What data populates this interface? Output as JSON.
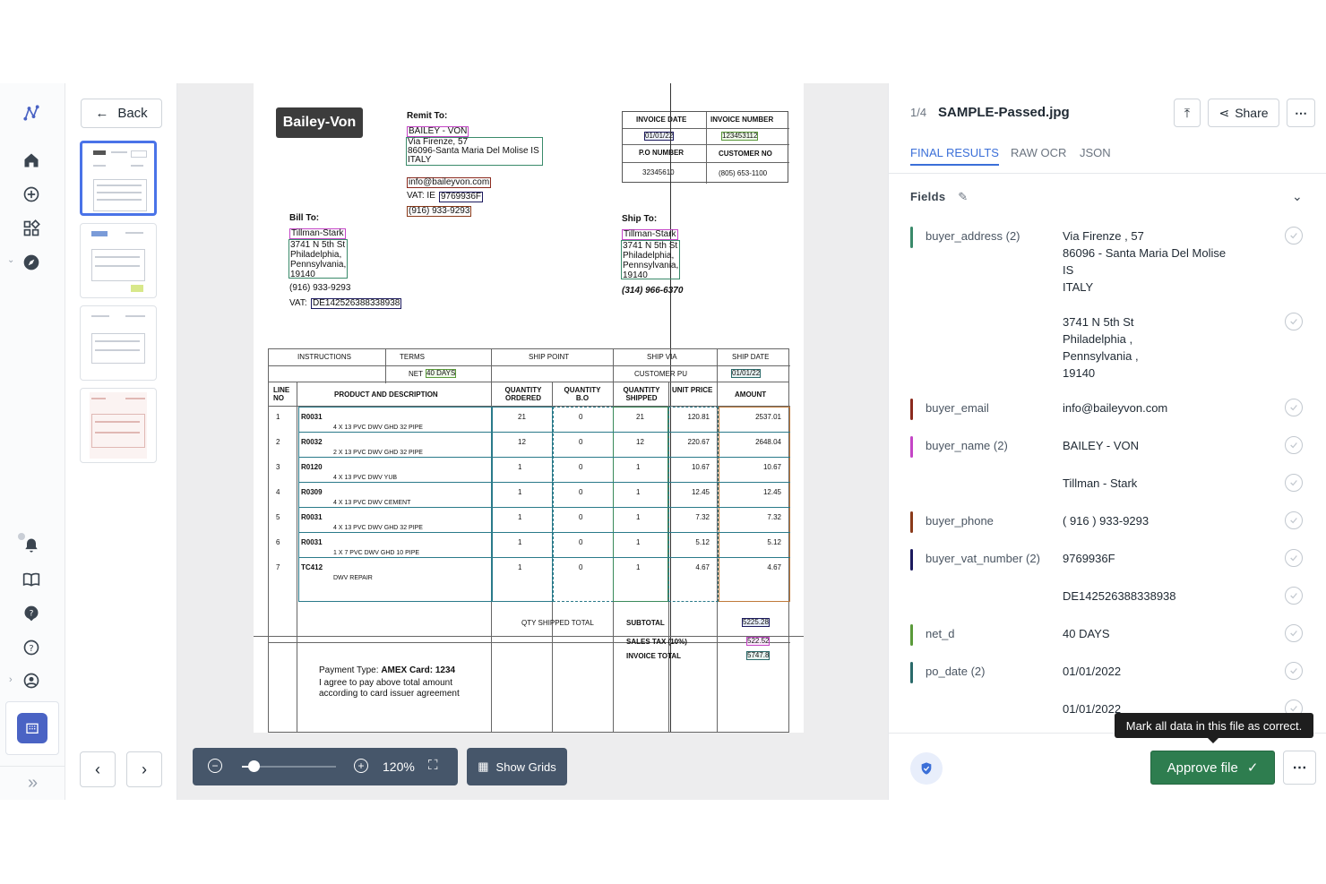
{
  "viewer": {
    "back_label": "Back",
    "zoom_level": "120%",
    "zoom_slider_value": 0.12,
    "show_grids_label": "Show Grids"
  },
  "document": {
    "vendor_logo": "Bailey-Von",
    "remit_to_label": "Remit To:",
    "remit_name": "BAILEY - VON",
    "remit_address": [
      "Via Firenze, 57",
      "86096-Santa Maria Del Molise IS",
      "ITALY"
    ],
    "remit_email": "info@baileyvon.com",
    "remit_vat_label": "VAT: IE",
    "remit_vat": "9769936F",
    "remit_phone": "(916) 933-9293",
    "invoice_date_label": "INVOICE DATE",
    "invoice_number_label": "INVOICE NUMBER",
    "invoice_date": "01/01/22",
    "invoice_number": "123453112",
    "po_number_label": "P.O NUMBER",
    "customer_no_label": "CUSTOMER NO",
    "po_number": "32345610",
    "customer_no": "(805) 653-1100",
    "bill_to_label": "Bill To:",
    "bill_name": "Tillman-Stark",
    "bill_address": [
      "3741 N 5th St",
      "Philadelphia,",
      "Pennsylvania,",
      "19140"
    ],
    "bill_phone": "(916) 933-9293",
    "bill_vat_label": "VAT:",
    "bill_vat": "DE142526388338938",
    "ship_to_label": "Ship To:",
    "ship_name": "Tillman-Stark",
    "ship_address": [
      "3741 N 5th St",
      "Philadelphia,",
      "Pennsylvania,",
      "19140"
    ],
    "ship_phone": "(314) 966-6370",
    "col_instructions": "INSTRUCTIONS",
    "col_terms": "TERMS",
    "col_ship_point": "SHIP POINT",
    "col_ship_via": "SHIP VIA",
    "col_ship_date": "SHIP DATE",
    "terms_value_prefix": "NET",
    "terms_value": "40 DAYS",
    "ship_via_value": "CUSTOMER PU",
    "ship_date_value": "01/01/22",
    "h_line_no": "LINE NO",
    "h_product": "PRODUCT AND DESCRIPTION",
    "h_qty_ordered": "QUANTITY ORDERED",
    "h_qty_bo": "QUANTITY B.O",
    "h_qty_shipped": "QUANTITY SHIPPED",
    "h_unit_price": "UNIT PRICE",
    "h_amount": "AMOUNT",
    "lines": [
      {
        "no": "1",
        "code": "R0031",
        "desc": "4 X 13 PVC DWV GHD 32 PIPE",
        "ordered": "21",
        "bo": "0",
        "shipped": "21",
        "price": "120.81",
        "amount": "2537.01"
      },
      {
        "no": "2",
        "code": "R0032",
        "desc": "2 X 13 PVC DWV GHD 32 PIPE",
        "ordered": "12",
        "bo": "0",
        "shipped": "12",
        "price": "220.67",
        "amount": "2648.04"
      },
      {
        "no": "3",
        "code": "R0120",
        "desc": "4 X 13 PVC DWV YUB",
        "ordered": "1",
        "bo": "0",
        "shipped": "1",
        "price": "10.67",
        "amount": "10.67"
      },
      {
        "no": "4",
        "code": "R0309",
        "desc": "4 X 13 PVC DWV CEMENT",
        "ordered": "1",
        "bo": "0",
        "shipped": "1",
        "price": "12.45",
        "amount": "12.45"
      },
      {
        "no": "5",
        "code": "R0031",
        "desc": "4 X 13 PVC DWV GHD 32 PIPE",
        "ordered": "1",
        "bo": "0",
        "shipped": "1",
        "price": "7.32",
        "amount": "7.32"
      },
      {
        "no": "6",
        "code": "R0031",
        "desc": "1 X 7 PVC DWV GHD 10 PIPE",
        "ordered": "1",
        "bo": "0",
        "shipped": "1",
        "price": "5.12",
        "amount": "5.12"
      },
      {
        "no": "7",
        "code": "TC412",
        "desc": "DWV REPAIR",
        "ordered": "1",
        "bo": "0",
        "shipped": "1",
        "price": "4.67",
        "amount": "4.67"
      }
    ],
    "qty_shipped_total_label": "QTY SHIPPED TOTAL",
    "subtotal_label": "SUBTOTAL",
    "subtotal": "5225.28",
    "sales_tax_label": "SALES TAX (10%)",
    "sales_tax": "522.52",
    "invoice_total_label": "INVOICE TOTAL",
    "invoice_total": "5747.8",
    "payment_type_label": "Payment Type:",
    "payment_type_value": "AMEX Card: 1234",
    "agreement_line1": "I agree to pay above total amount",
    "agreement_line2": "according to card issuer agreement"
  },
  "panel": {
    "page_count": "1/4",
    "file_name": "SAMPLE-Passed.jpg",
    "share_label": "Share",
    "tabs": [
      "FINAL RESULTS",
      "RAW OCR",
      "JSON"
    ],
    "fields_title": "Fields",
    "fields": [
      {
        "name": "buyer_address (2)",
        "color": "#3a8a6a",
        "value": "Via Firenze , 57\n86096 - Santa Maria Del Molise\nIS\nITALY"
      },
      {
        "name": "",
        "color": "",
        "value": "3741 N 5th St\nPhiladelphia ,\nPennsylvania ,\n19140"
      },
      {
        "name": "buyer_email",
        "color": "#8b2a1e",
        "value": "info@baileyvon.com"
      },
      {
        "name": "buyer_name (2)",
        "color": "#c445c6",
        "value": "BAILEY - VON"
      },
      {
        "name": "",
        "color": "",
        "value": "Tillman - Stark"
      },
      {
        "name": "buyer_phone",
        "color": "#8a3a1a",
        "value": "( 916 ) 933-9293"
      },
      {
        "name": "buyer_vat_number (2)",
        "color": "#1c1a5e",
        "value": "9769936F"
      },
      {
        "name": "",
        "color": "",
        "value": "DE142526388338938"
      },
      {
        "name": "net_d",
        "color": "#5a9a3a",
        "value": "40 DAYS"
      },
      {
        "name": "po_date (2)",
        "color": "#2a6a6a",
        "value": "01/01/2022"
      },
      {
        "name": "",
        "color": "",
        "value": "01/01/2022"
      }
    ],
    "tooltip": "Mark all data in this file as correct.",
    "approve_label": "Approve file"
  }
}
